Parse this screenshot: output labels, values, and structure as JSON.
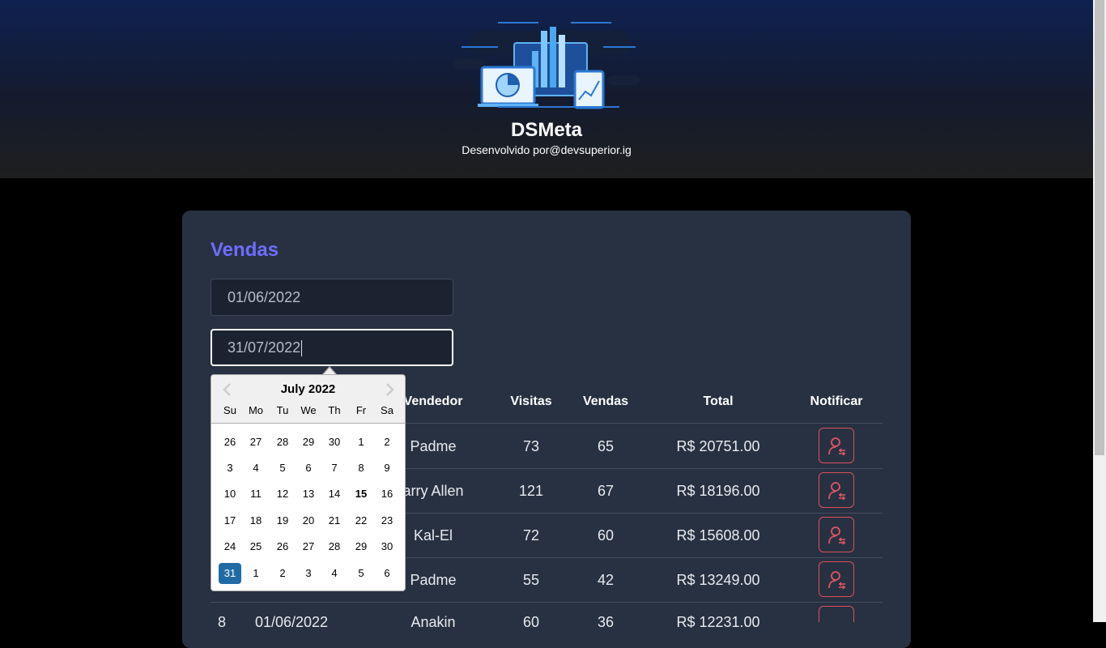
{
  "header": {
    "title": "DSMeta",
    "subtitle": "Desenvolvido por@devsuperior.ig",
    "logo_icon": "sales-dashboard-illustration"
  },
  "card": {
    "title": "Vendas"
  },
  "filters": {
    "min_date": "01/06/2022",
    "max_date": "31/07/2022"
  },
  "table": {
    "headers": {
      "vendedor": "Vendedor",
      "visitas": "Visitas",
      "vendas": "Vendas",
      "total": "Total",
      "notificar": "Notificar"
    },
    "rows": [
      {
        "vendedor": "Padme",
        "visitas": "73",
        "vendas": "65",
        "total": "R$ 20751.00"
      },
      {
        "vendedor": "arry Allen",
        "visitas": "121",
        "vendas": "67",
        "total": "R$ 18196.00"
      },
      {
        "vendedor": "Kal-El",
        "visitas": "72",
        "vendas": "60",
        "total": "R$ 15608.00"
      },
      {
        "vendedor": "Padme",
        "visitas": "55",
        "vendas": "42",
        "total": "R$ 13249.00"
      }
    ],
    "partial_row": {
      "id": "8",
      "date": "01/06/2022",
      "vendedor": "Anakin",
      "visitas": "60",
      "vendas": "36",
      "total": "R$ 12231.00"
    }
  },
  "calendar": {
    "month_label": "July 2022",
    "weekdays": [
      "Su",
      "Mo",
      "Tu",
      "We",
      "Th",
      "Fr",
      "Sa"
    ],
    "weeks": [
      [
        "26",
        "27",
        "28",
        "29",
        "30",
        "1",
        "2"
      ],
      [
        "3",
        "4",
        "5",
        "6",
        "7",
        "8",
        "9"
      ],
      [
        "10",
        "11",
        "12",
        "13",
        "14",
        "15",
        "16"
      ],
      [
        "17",
        "18",
        "19",
        "20",
        "21",
        "22",
        "23"
      ],
      [
        "24",
        "25",
        "26",
        "27",
        "28",
        "29",
        "30"
      ],
      [
        "31",
        "1",
        "2",
        "3",
        "4",
        "5",
        "6"
      ]
    ],
    "today": "15",
    "selected": "31",
    "colors": {
      "selected_bg": "#216ba5",
      "accent_title": "#6f6dff",
      "notify_border": "#d8505d"
    }
  }
}
